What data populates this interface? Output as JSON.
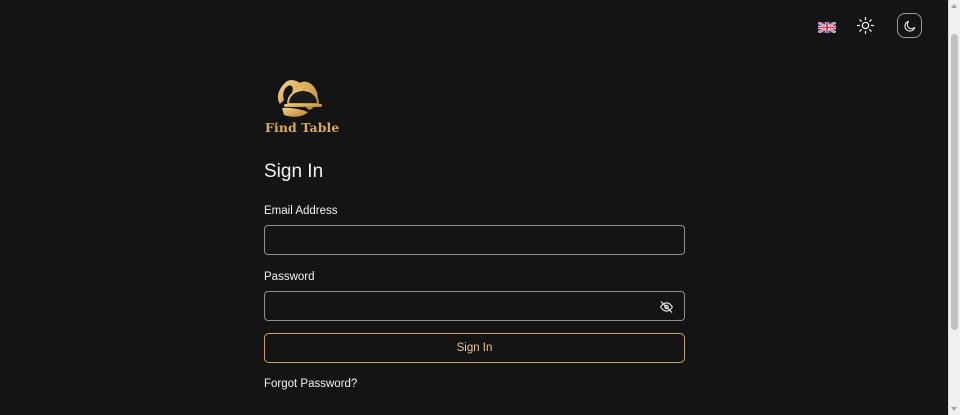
{
  "header": {
    "language_flag": "uk-flag-icon",
    "light_mode_icon": "sun-icon",
    "dark_mode_icon": "moon-icon"
  },
  "brand": {
    "name": "Find Table",
    "logo_icon": "chef-cloche-icon",
    "color": "#d9aa5a"
  },
  "form": {
    "title": "Sign In",
    "email_label": "Email Address",
    "email_value": "",
    "password_label": "Password",
    "password_value": "",
    "password_toggle_icon": "eye-off-icon",
    "submit_label": "Sign In",
    "forgot_label": "Forgot Password?"
  },
  "colors": {
    "background": "#141414",
    "accent": "#c9a06a"
  }
}
